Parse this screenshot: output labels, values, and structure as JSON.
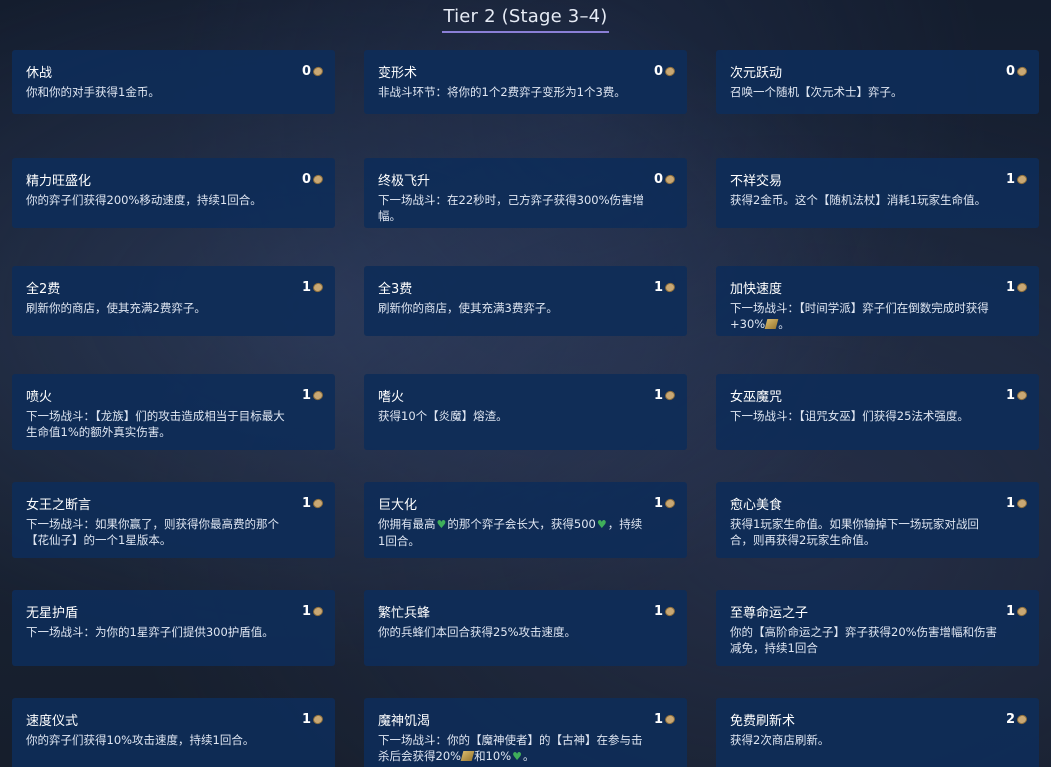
{
  "heading": "Tier 2 (Stage 3–4)",
  "colors": {
    "card_bg": "#0e2d58",
    "heading_underline": "#8a7fd6",
    "coin": "#c9a874",
    "heart": "#3fae5a"
  },
  "cards": [
    {
      "title": "休战",
      "cost": "0",
      "desc": "你和你的对手获得1金币。"
    },
    {
      "title": "变形术",
      "cost": "0",
      "desc": "非战斗环节：将你的1个2费弈子变形为1个3费。"
    },
    {
      "title": "次元跃动",
      "cost": "0",
      "desc": "召唤一个随机【次元术士】弈子。"
    },
    {
      "title": "精力旺盛化",
      "cost": "0",
      "desc": "你的弈子们获得200%移动速度，持续1回合。"
    },
    {
      "title": "终极飞升",
      "cost": "0",
      "desc": "下一场战斗：在22秒时，己方弈子获得300%伤害增\n幅。"
    },
    {
      "title": "不祥交易",
      "cost": "1",
      "desc": "获得2金币。这个【随机法杖】消耗1玩家生命值。"
    },
    {
      "title": "全2费",
      "cost": "1",
      "desc": "刷新你的商店，使其充满2费弈子。"
    },
    {
      "title": "全3费",
      "cost": "1",
      "desc": "刷新你的商店，使其充满3费弈子。"
    },
    {
      "title": "加快速度",
      "cost": "1",
      "desc_a": "下一场战斗：【时间学派】弈子们在倒数完成时获得\n+30%",
      "desc_b": "。"
    },
    {
      "title": "喷火",
      "cost": "1",
      "desc": "下一场战斗：【龙族】们的攻击造成相当于目标最大\n生命值1%的额外真实伤害。"
    },
    {
      "title": "嗜火",
      "cost": "1",
      "desc": "获得10个【炎魔】熔渣。"
    },
    {
      "title": "女巫魔咒",
      "cost": "1",
      "desc": "下一场战斗：【诅咒女巫】们获得25法术强度。"
    },
    {
      "title": "女王之断言",
      "cost": "1",
      "desc": "下一场战斗：如果你赢了，则获得你最高费的那个\n【花仙子】的一个1星版本。"
    },
    {
      "title": "巨大化",
      "cost": "1",
      "desc_a": "你拥有最高",
      "desc_b": "的那个弈子会长大，获得500",
      "desc_c": "，持续\n1回合。"
    },
    {
      "title": "愈心美食",
      "cost": "1",
      "desc": "获得1玩家生命值。如果你输掉下一场玩家对战回\n合，则再获得2玩家生命值。"
    },
    {
      "title": "无星护盾",
      "cost": "1",
      "desc": "下一场战斗：为你的1星弈子们提供300护盾值。"
    },
    {
      "title": "繁忙兵蜂",
      "cost": "1",
      "desc": "你的兵蜂们本回合获得25%攻击速度。"
    },
    {
      "title": "至尊命运之子",
      "cost": "1",
      "desc": "你的【高阶命运之子】弈子获得20%伤害增幅和伤害\n减免，持续1回合"
    },
    {
      "title": "速度仪式",
      "cost": "1",
      "desc": "你的弈子们获得10%攻击速度，持续1回合。"
    },
    {
      "title": "魔神饥渴",
      "cost": "1",
      "desc_a": "下一场战斗：你的【魔神使者】的【古神】在参与击\n杀后会获得20%",
      "desc_b": "和10%",
      "desc_c": "。"
    },
    {
      "title": "免费刷新术",
      "cost": "2",
      "desc": "获得2次商店刷新。"
    }
  ]
}
